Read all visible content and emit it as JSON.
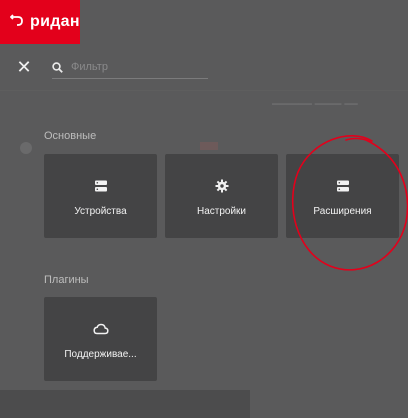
{
  "brand": {
    "name": "ридан",
    "accent": "#e3001b"
  },
  "search": {
    "placeholder": "Фильтр"
  },
  "sections": {
    "main": {
      "title": "Основные",
      "tiles": [
        {
          "label": "Устройства",
          "icon": "server-icon"
        },
        {
          "label": "Настройки",
          "icon": "gear-icon"
        },
        {
          "label": "Расширения",
          "icon": "server-icon"
        }
      ]
    },
    "plugins": {
      "title": "Плагины",
      "tiles": [
        {
          "label": "Поддерживае...",
          "icon": "cloud-icon"
        }
      ]
    }
  },
  "annotation": {
    "color": "#e3001b",
    "target": "Расширения"
  }
}
